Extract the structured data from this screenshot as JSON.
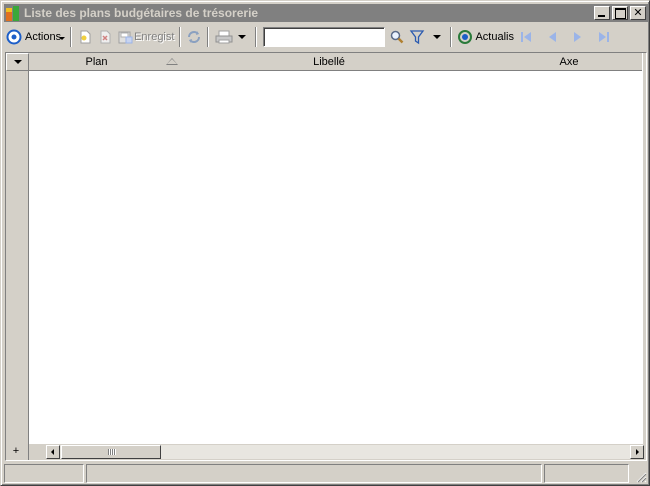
{
  "window": {
    "title": "Liste des plans budgétaires de trésorerie"
  },
  "toolbar": {
    "actions_label": "Actions",
    "save_label": "Enregist",
    "refresh_label": "Actualis",
    "search": {
      "value": "",
      "placeholder": ""
    }
  },
  "grid": {
    "columns": [
      {
        "label": "Plan",
        "sorted": "ascending"
      },
      {
        "label": "Libellé"
      },
      {
        "label": "Axe"
      }
    ],
    "rows": []
  },
  "bottom": {
    "add_label": "+"
  },
  "colors": {
    "chrome": "#d4d0c8",
    "title_inactive": "#808080",
    "accent_blue": "#1c5ec8",
    "nav_disabled": "#9bb4e8"
  }
}
